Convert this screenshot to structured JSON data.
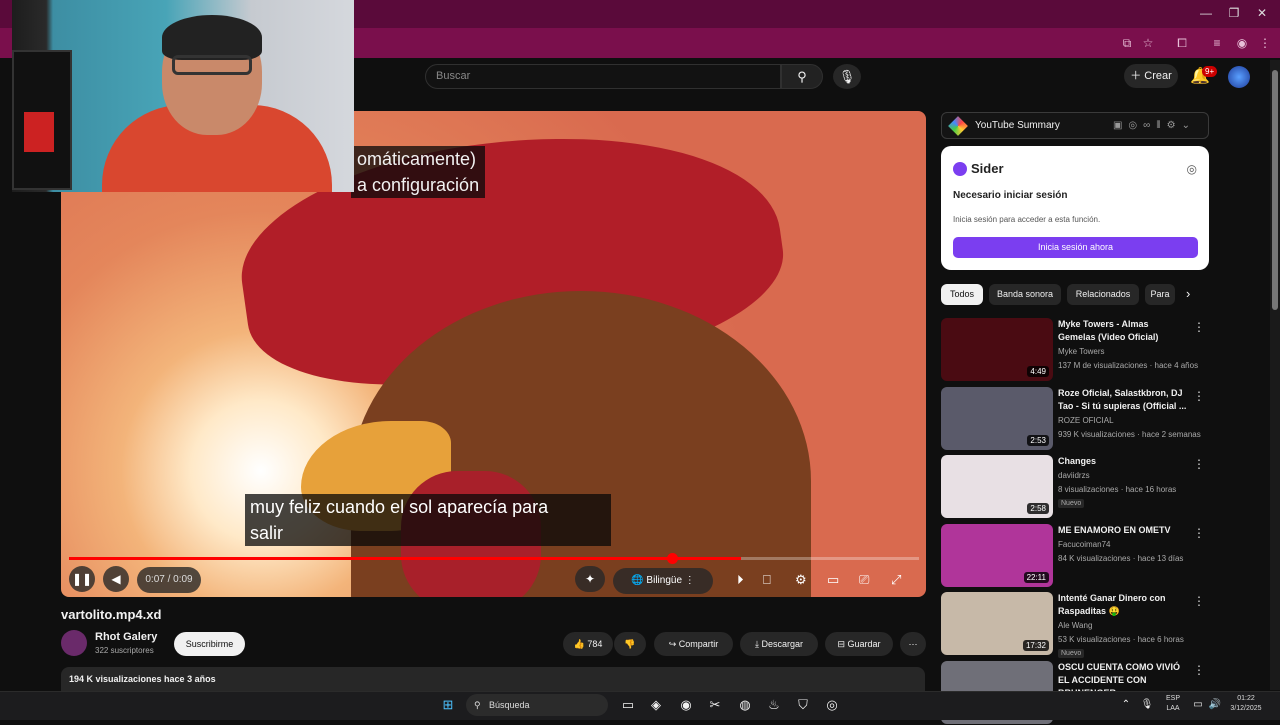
{
  "search": {
    "placeholder": "Buscar"
  },
  "header": {
    "create_label": "Crear",
    "notif_badge": "9+"
  },
  "player": {
    "subtitle_top": [
      "omáticamente)",
      "a configuración"
    ],
    "subtitle_bottom": [
      "muy feliz cuando el sol aparecía para",
      "salir"
    ],
    "time": "0:07 / 0:09",
    "progress": 0.79,
    "bilingual_label": "Bilingüe"
  },
  "video": {
    "title": "vartolito.mp4.xd",
    "channel": "Rhot Galery",
    "subscribers": "322 suscriptores",
    "subscribe_label": "Suscribirme",
    "likes": "784",
    "share_label": "Compartir",
    "download_label": "Descargar",
    "save_label": "Guardar",
    "views_line": "194 K visualizaciones  hace 3 años"
  },
  "extension": {
    "summary_title": "YouTube Summary",
    "sider_title": "Sider",
    "sider_heading": "Necesario iniciar sesión",
    "sider_text": "Inicia sesión para acceder a esta función.",
    "sider_button": "Inicia sesión ahora"
  },
  "chips": [
    "Todos",
    "Banda sonora",
    "Relacionados",
    "Para"
  ],
  "recommendations": [
    {
      "title": "Myke Towers - Almas Gemelas (Video Oficial)",
      "channel": "Myke Towers",
      "meta": "137 M de visualizaciones · hace 4 años",
      "duration": "4:49",
      "thumb_color": "#4a0b12"
    },
    {
      "title": "Roze Oficial, Salastkbron, DJ Tao - Si tú supieras (Official ...",
      "channel": "ROZE OFICIAL",
      "meta": "939 K visualizaciones · hace 2 semanas",
      "duration": "2:53",
      "thumb_color": "#5a5a6a"
    },
    {
      "title": "Changes",
      "channel": "daviidrzs",
      "meta": "8 visualizaciones · hace 16 horas",
      "duration": "2:58",
      "new": "Nuevo",
      "thumb_color": "#e8e0e4"
    },
    {
      "title": "ME ENAMORO EN OMETV",
      "channel": "Facucoiman74",
      "meta": "84 K visualizaciones · hace 13 días",
      "duration": "22:11",
      "thumb_color": "#b0359a"
    },
    {
      "title": "Intenté Ganar Dinero con Raspaditas 🤑",
      "channel": "Ale Wang",
      "meta": "53 K visualizaciones · hace 6 horas",
      "duration": "17:32",
      "new": "Nuevo",
      "thumb_color": "#c7b9a8"
    },
    {
      "title": "OSCU CUENTA COMO VIVIÓ EL ACCIDENTE CON BRUNENGER",
      "channel": "",
      "meta": "",
      "duration": "",
      "thumb_color": "#6f6f78"
    }
  ],
  "taskbar": {
    "search_label": "Búsqueda",
    "lang": "ESP",
    "region": "LAA",
    "time": "01:22",
    "date": "3/12/2025"
  }
}
